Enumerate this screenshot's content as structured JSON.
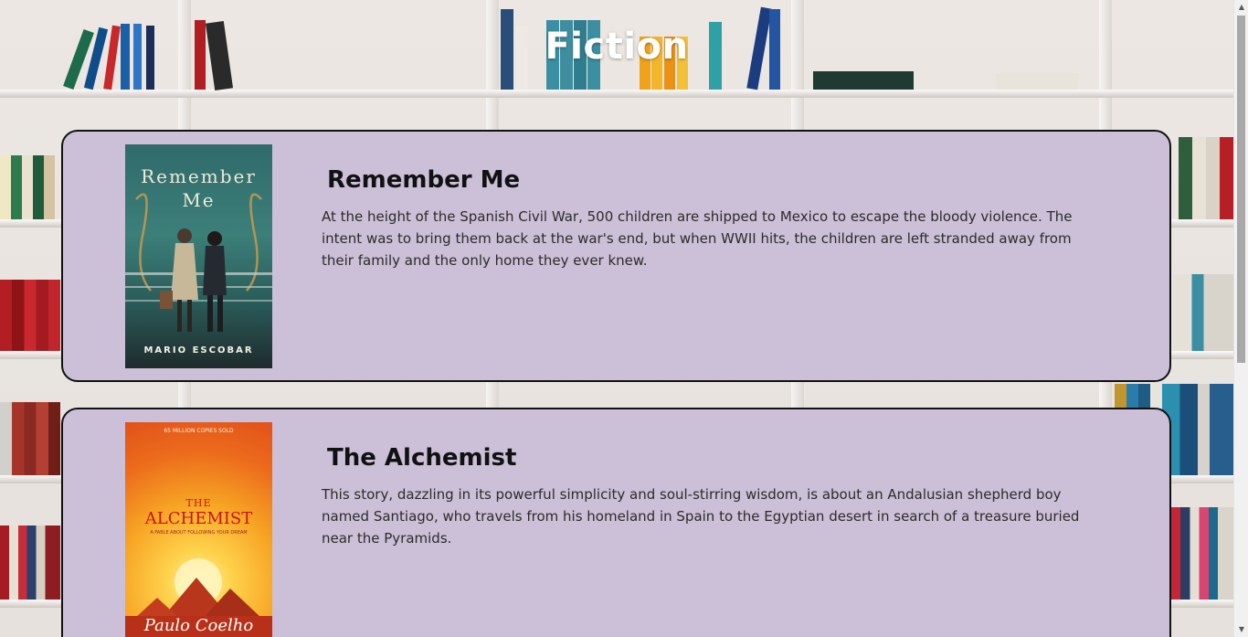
{
  "page": {
    "title": "Fiction"
  },
  "books": [
    {
      "title": "Remember Me",
      "description": "At the height of the Spanish Civil War, 500 children are shipped to Mexico to escape the bloody violence. The intent was to bring them back at the war's end, but when WWII hits, the children are left stranded away from their family and the only home they ever knew.",
      "cover": {
        "title_line1": "Remember",
        "title_line2": "Me",
        "author": "MARIO ESCOBAR"
      }
    },
    {
      "title": "The Alchemist",
      "description": "This story, dazzling in its powerful simplicity and soul-stirring wisdom, is about an Andalusian shepherd boy named Santiago, who travels from his homeland in Spain to the Egyptian desert in search of a treasure buried near the Pyramids.",
      "cover": {
        "top_text": "65 MILLION COPIES SOLD",
        "the": "THE",
        "title": "ALCHEMIST",
        "tagline": "A FABLE ABOUT FOLLOWING YOUR DREAM",
        "author": "Paulo Coelho"
      }
    }
  ],
  "colors": {
    "card_background": "#ccbfd8",
    "card_border": "#111111",
    "title_color": "#ffffff"
  }
}
